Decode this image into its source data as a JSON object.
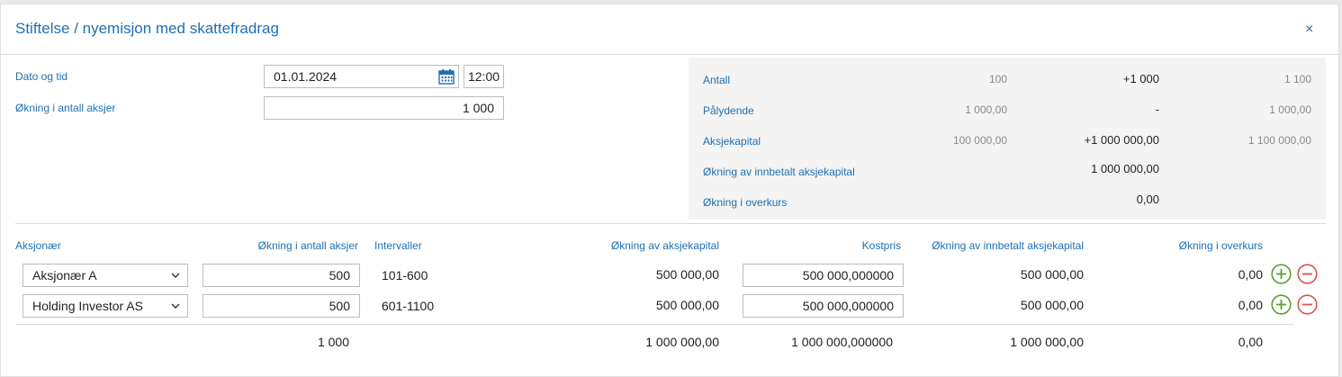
{
  "dialog": {
    "title": "Stiftelse / nyemisjon med skattefradrag",
    "close_glyph": "×"
  },
  "form": {
    "date_label": "Dato og tid",
    "date_value": "01.01.2024",
    "time_value": "12:00",
    "shares_label": "Økning i antall aksjer",
    "shares_value": "1 000"
  },
  "summary": {
    "rows": [
      {
        "label": "Antall",
        "before": "100",
        "change": "+1 000",
        "after": "1 100"
      },
      {
        "label": "Pålydende",
        "before": "1 000,00",
        "change": "-",
        "after": "1 000,00"
      },
      {
        "label": "Aksjekapital",
        "before": "100 000,00",
        "change": "+1 000 000,00",
        "after": "1 100 000,00"
      },
      {
        "label": "Økning av innbetalt aksjekapital",
        "change": "1 000 000,00"
      },
      {
        "label": "Økning i overkurs",
        "change": "0,00"
      }
    ]
  },
  "table": {
    "headers": {
      "shareholder": "Aksjonær",
      "shares": "Økning i antall aksjer",
      "intervals": "Intervaller",
      "capital": "Økning av aksjekapital",
      "cost": "Kostpris",
      "paid": "Økning av innbetalt aksjekapital",
      "premium": "Økning i overkurs"
    },
    "rows": [
      {
        "shareholder": "Aksjonær A",
        "shares": "500",
        "interval": "101-600",
        "capital": "500 000,00",
        "cost": "500 000,000000",
        "paid": "500 000,00",
        "premium": "0,00"
      },
      {
        "shareholder": "Holding Investor AS",
        "shares": "500",
        "interval": "601-1100",
        "capital": "500 000,00",
        "cost": "500 000,000000",
        "paid": "500 000,00",
        "premium": "0,00"
      }
    ],
    "totals": {
      "shares": "1 000",
      "capital": "1 000 000,00",
      "cost": "1 000 000,000000",
      "paid": "1 000 000,00",
      "premium": "0,00"
    }
  },
  "colors": {
    "accent": "#1f6fb2",
    "add": "#5aa02c",
    "remove": "#d9534f"
  },
  "icons": {
    "calendar": "calendar-icon",
    "chevron": "chevron-down-icon",
    "add": "plus-circle-icon",
    "remove": "minus-circle-icon",
    "close": "close-icon"
  }
}
